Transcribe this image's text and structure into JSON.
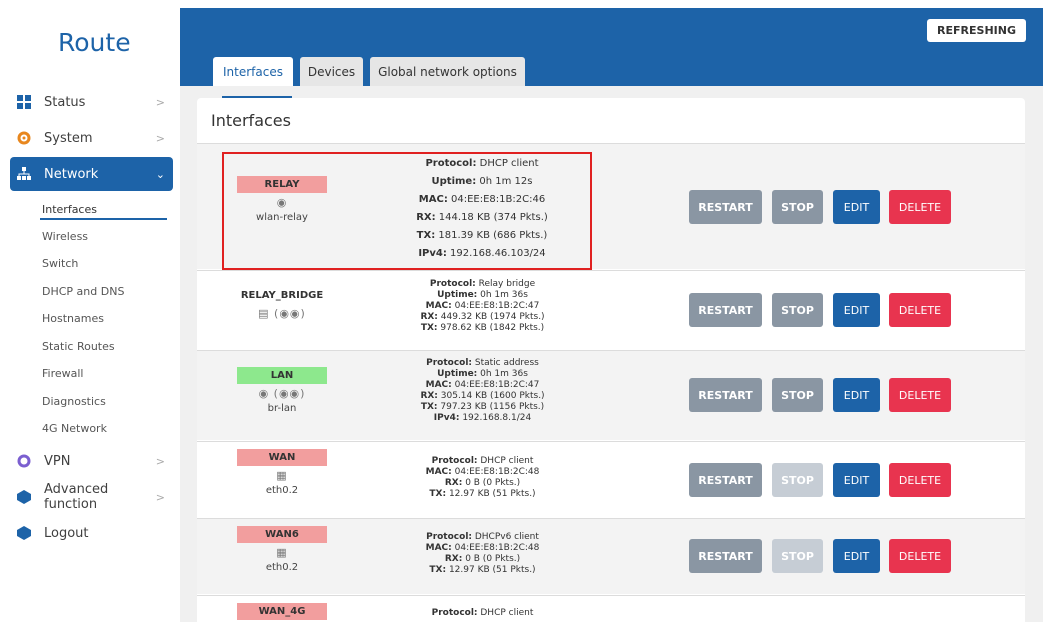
{
  "brand": "Route",
  "sidebar": {
    "items": [
      {
        "label": "Status",
        "arrow": ">"
      },
      {
        "label": "System",
        "arrow": ">"
      },
      {
        "label": "Network",
        "arrow": "⌄"
      },
      {
        "label": "VPN",
        "arrow": ">"
      },
      {
        "label": "Advanced function",
        "arrow": ">"
      },
      {
        "label": "Logout",
        "arrow": ""
      }
    ],
    "network_subitems": [
      "Interfaces",
      "Wireless",
      "Switch",
      "DHCP and DNS",
      "Hostnames",
      "Static Routes",
      "Firewall",
      "Diagnostics",
      "4G Network"
    ]
  },
  "header": {
    "refresh_label": "REFRESHING",
    "tabs": [
      "Interfaces",
      "Devices",
      "Global network options"
    ]
  },
  "panel": {
    "title": "Interfaces"
  },
  "buttons": {
    "restart": "RESTART",
    "stop": "STOP",
    "edit": "EDIT",
    "delete": "DELETE"
  },
  "colors": {
    "accent": "#1d63a8",
    "relay": "#f29e9e",
    "lan": "#8de88d",
    "wan": "#f29e9e",
    "delete": "#e8344f"
  },
  "interfaces": [
    {
      "name": "RELAY",
      "device": "wlan-relay",
      "icon": "wifi-icon",
      "details": [
        {
          "k": "Protocol:",
          "v": " DHCP client"
        },
        {
          "k": "Uptime:",
          "v": " 0h 1m 12s"
        },
        {
          "k": "MAC:",
          "v": " 04:EE:E8:1B:2C:46"
        },
        {
          "k": "RX:",
          "v": " 144.18 KB (374 Pkts.)"
        },
        {
          "k": "TX:",
          "v": " 181.39 KB (686 Pkts.)"
        },
        {
          "k": "IPv4:",
          "v": " 192.168.46.103/24"
        }
      ]
    },
    {
      "name": "RELAY_BRIDGE",
      "device": "",
      "icon": "bridge-icon",
      "details": [
        {
          "k": "Protocol:",
          "v": " Relay bridge"
        },
        {
          "k": "Uptime:",
          "v": " 0h 1m 36s"
        },
        {
          "k": "MAC:",
          "v": " 04:EE:E8:1B:2C:47"
        },
        {
          "k": "RX:",
          "v": " 449.32 KB (1974 Pkts.)"
        },
        {
          "k": "TX:",
          "v": " 978.62 KB (1842 Pkts.)"
        }
      ]
    },
    {
      "name": "LAN",
      "device": "br-lan",
      "icon": "bridge-icon",
      "details": [
        {
          "k": "Protocol:",
          "v": " Static address"
        },
        {
          "k": "Uptime:",
          "v": " 0h 1m 36s"
        },
        {
          "k": "MAC:",
          "v": " 04:EE:E8:1B:2C:47"
        },
        {
          "k": "RX:",
          "v": " 305.14 KB (1600 Pkts.)"
        },
        {
          "k": "TX:",
          "v": " 797.23 KB (1156 Pkts.)"
        },
        {
          "k": "IPv4:",
          "v": " 192.168.8.1/24"
        }
      ]
    },
    {
      "name": "WAN",
      "device": "eth0.2",
      "icon": "ethernet-icon",
      "details": [
        {
          "k": "Protocol:",
          "v": " DHCP client"
        },
        {
          "k": "MAC:",
          "v": " 04:EE:E8:1B:2C:48"
        },
        {
          "k": "RX:",
          "v": " 0 B (0 Pkts.)"
        },
        {
          "k": "TX:",
          "v": " 12.97 KB (51 Pkts.)"
        }
      ]
    },
    {
      "name": "WAN6",
      "device": "eth0.2",
      "icon": "ethernet-icon",
      "details": [
        {
          "k": "Protocol:",
          "v": " DHCPv6 client"
        },
        {
          "k": "MAC:",
          "v": " 04:EE:E8:1B:2C:48"
        },
        {
          "k": "RX:",
          "v": " 0 B (0 Pkts.)"
        },
        {
          "k": "TX:",
          "v": " 12.97 KB (51 Pkts.)"
        }
      ]
    },
    {
      "name": "WAN_4G",
      "device": "",
      "icon": "",
      "details": [
        {
          "k": "Protocol:",
          "v": " DHCP client"
        }
      ]
    }
  ]
}
